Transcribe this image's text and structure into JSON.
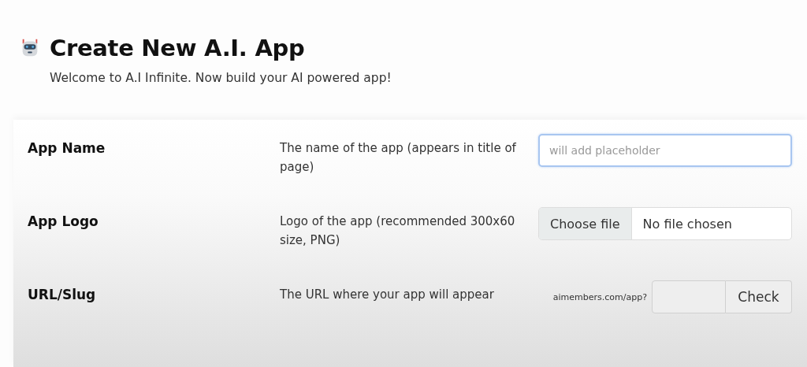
{
  "header": {
    "title": "Create New A.I. App",
    "subtitle": "Welcome to A.I Infinite. Now build your AI powered app!"
  },
  "fields": [
    {
      "kind": "text",
      "label": "App Name",
      "description": "The name of the app (appears in title of page)",
      "placeholder": "will add placeholder",
      "focused": true
    },
    {
      "kind": "file",
      "label": "App Logo",
      "description": "Logo of the app (recommended 300x60 size, PNG)",
      "button": "Choose file",
      "status": "No file chosen"
    },
    {
      "kind": "slug",
      "label": "URL/Slug",
      "description": "The URL where your app will appear",
      "prefix": "aimembers.com/app?",
      "button": "Check"
    }
  ]
}
